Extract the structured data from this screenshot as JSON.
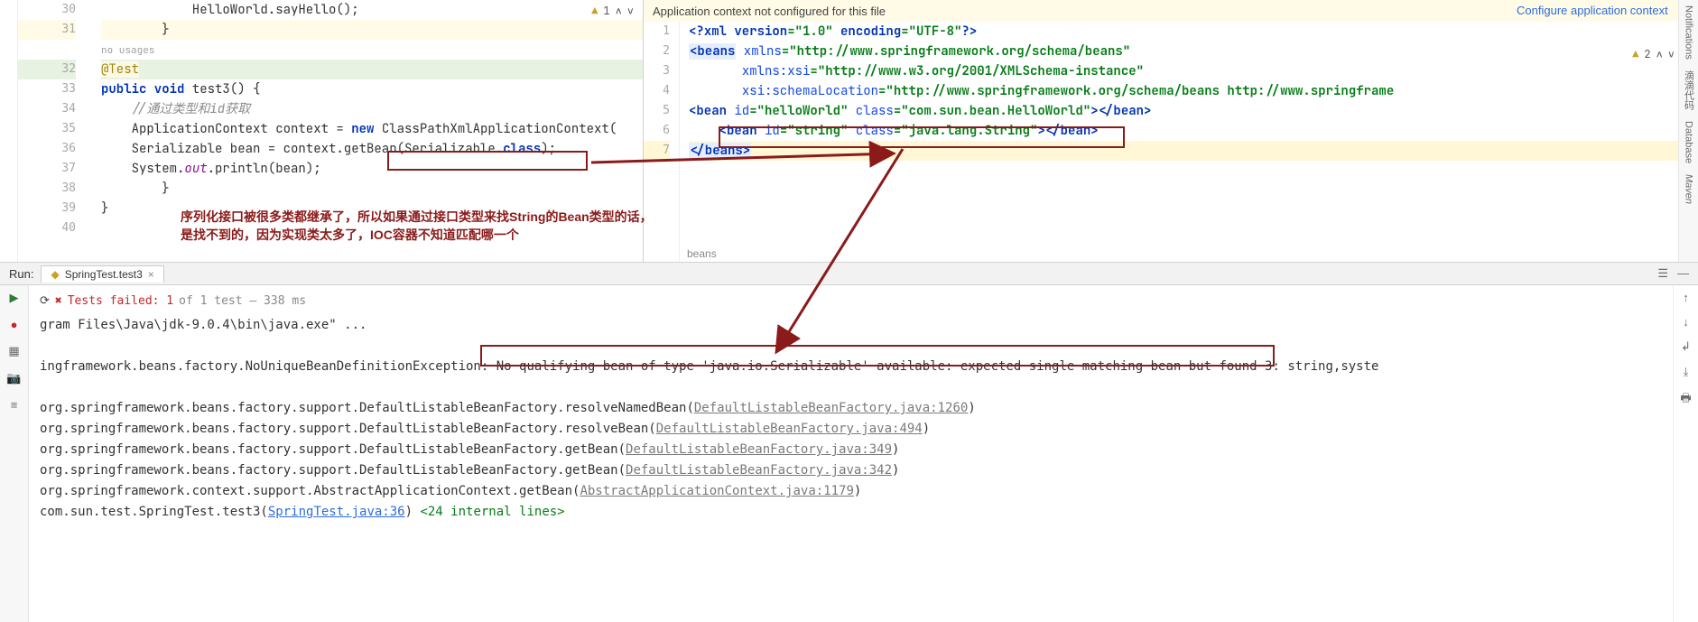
{
  "left_editor": {
    "line_numbers": [
      "30",
      "31",
      "",
      "32",
      "33",
      "34",
      "35",
      "36",
      "37",
      "38",
      "39",
      "40"
    ],
    "lines": {
      "l30": "            HelloWorld.sayHello();",
      "l31": "        }",
      "usages": "no usages",
      "test_ann": "@Test",
      "l33_a": "public",
      "l33_b": " void",
      "l33_c": " test3() {",
      "l34": "//通过类型和id获取",
      "l35_a": "ApplicationContext context = ",
      "l35_kw": "new",
      "l35_b": " ClassPathXmlApplicationContext(",
      "l36_a": "Serializable bean = context.getBean(Serializable.",
      "l36_b": "class",
      "l36_c": ");",
      "l37_a": "System.",
      "l37_b": "out",
      "l37_c": ".println(bean);",
      "l38": "        }",
      "l39": "}",
      "l40": ""
    },
    "status": {
      "warn_count": "1"
    }
  },
  "right_editor": {
    "banner_text": "Application context not configured for this file",
    "banner_link": "Configure application context",
    "line_numbers": [
      "1",
      "2",
      "3",
      "4",
      "5",
      "6",
      "7"
    ],
    "lines": {
      "xml_decl_a": "<?",
      "xml_decl_b": "xml version",
      "xml_decl_c": "=\"1.0\"",
      "xml_decl_d": " encoding",
      "xml_decl_e": "=\"UTF-8\"",
      "xml_decl_f": "?>",
      "beans_open": "<beans",
      "beans_attr1": " xmlns",
      "beans_val1": "=\"http://www.springframework.org/schema/beans\"",
      "xsi_attr": "xmlns:xsi",
      "xsi_val": "=\"http://www.w3.org/2001/XMLSchema-instance\"",
      "loc_attr": "xsi:schemaLocation",
      "loc_val": "=\"http://www.springframework.org/schema/beans http://www.springframe",
      "bean1_a": "<bean",
      "bean1_b": " id",
      "bean1_c": "=\"helloWorld\"",
      "bean1_d": " class",
      "bean1_e": "=\"com.sun.bean.HelloWorld\"",
      "bean1_f": ">",
      "bean1_g": "</bean>",
      "bean2_a": "<bean",
      "bean2_b": " id",
      "bean2_c": "=\"string\"",
      "bean2_d": " class",
      "bean2_e": "=\"java.lang.String\"",
      "bean2_f": ">",
      "bean2_g": "</bean>",
      "beans_close": "</beans>"
    },
    "crumb": "beans",
    "status": {
      "warn_count": "2"
    }
  },
  "annotation": {
    "line1": "序列化接口被很多类都继承了，所以如果通过接口类型来找String的Bean类型的话，",
    "line2": "是找不到的，因为实现类太多了，IOC容器不知道匹配哪一个"
  },
  "run": {
    "label": "Run:",
    "tab": "SpringTest.test3",
    "fail_prefix": "Tests failed: 1",
    "fail_suffix": " of 1 test – 338 ms",
    "console": {
      "c0": "gram Files\\Java\\jdk-9.0.4\\bin\\java.exe\" ...",
      "exc_prefix": "ingframework.beans.factory.NoUniqueBeanDefinitionException:",
      "exc_msg": " No qualifying bean of type 'java.io.Serializable' available: expected single matching bean but found 3: ",
      "exc_tail": "string,syste",
      "s1_a": "org.springframework.beans.factory.support.DefaultListableBeanFactory.resolveNamedBean(",
      "s1_l": "DefaultListableBeanFactory.java:1260",
      "s1_b": ")",
      "s2_a": "org.springframework.beans.factory.support.DefaultListableBeanFactory.resolveBean(",
      "s2_l": "DefaultListableBeanFactory.java:494",
      "s2_b": ")",
      "s3_a": "org.springframework.beans.factory.support.DefaultListableBeanFactory.getBean(",
      "s3_l": "DefaultListableBeanFactory.java:349",
      "s3_b": ")",
      "s4_a": "org.springframework.beans.factory.support.DefaultListableBeanFactory.getBean(",
      "s4_l": "DefaultListableBeanFactory.java:342",
      "s4_b": ")",
      "s5_a": "org.springframework.context.support.AbstractApplicationContext.getBean(",
      "s5_l": "AbstractApplicationContext.java:1179",
      "s5_b": ")",
      "s6_a": "com.sun.test.SpringTest.test3(",
      "s6_l": "SpringTest.java:36",
      "s6_b": ") ",
      "s6_c": "<24 internal lines>"
    }
  },
  "right_rail": {
    "a": "Notifications",
    "b": "滴滴代码",
    "c": "Database",
    "d": "Maven"
  }
}
